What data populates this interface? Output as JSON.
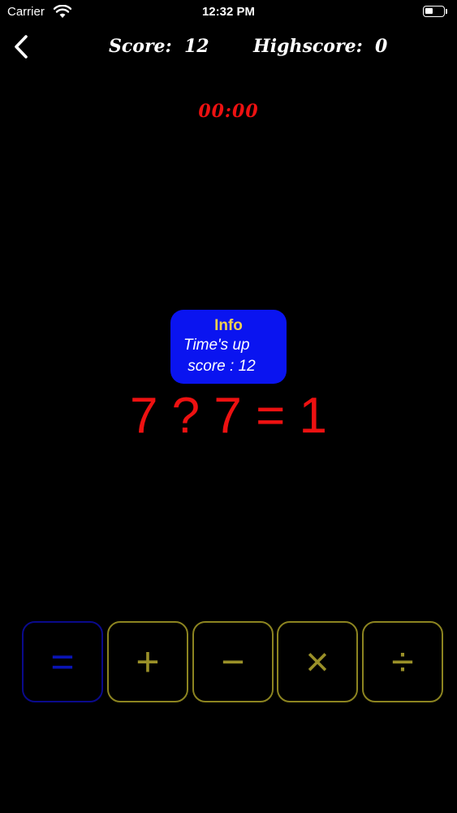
{
  "status_bar": {
    "carrier": "Carrier",
    "time": "12:32 PM",
    "wifi_icon": "wifi-icon",
    "battery_icon": "battery-icon"
  },
  "header": {
    "back_icon": "chevron-left-icon",
    "score_text": "Score:  12",
    "highscore_text": "Highscore:  0"
  },
  "timer": "00:00",
  "info": {
    "title": "Info",
    "line1": "Time's up",
    "line2": " score : 12"
  },
  "equation": "7 ? 7 = 1",
  "operators": [
    {
      "label": "=",
      "selected": true
    },
    {
      "label": "+",
      "selected": false
    },
    {
      "label": "−",
      "selected": false
    },
    {
      "label": "×",
      "selected": false
    },
    {
      "label": "÷",
      "selected": false
    }
  ],
  "colors": {
    "background": "#000000",
    "timer": "#ee1111",
    "equation": "#ee1111",
    "info_bg": "#0a14f0",
    "info_title": "#f0d050",
    "operator": "#9a9028",
    "operator_selected": "#0a14b4"
  }
}
